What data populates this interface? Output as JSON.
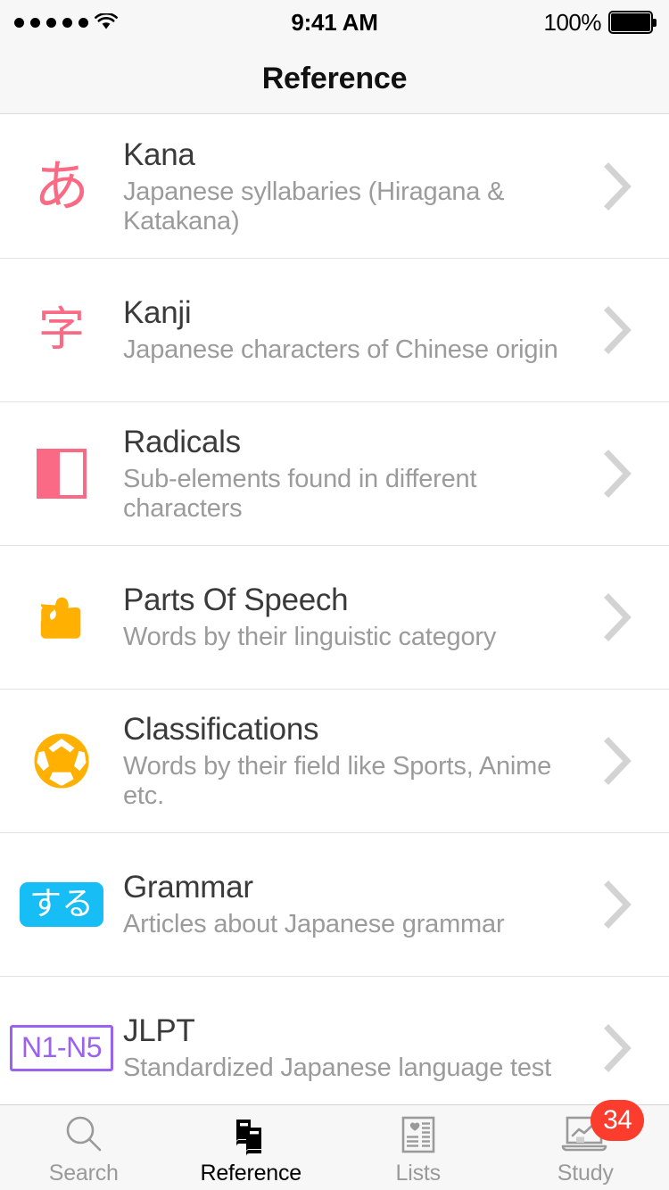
{
  "status_bar": {
    "signal_dots": 5,
    "wifi_icon": "wifi-icon",
    "time": "9:41 AM",
    "battery_percent": "100%",
    "battery_icon": "battery-full-icon"
  },
  "nav": {
    "title": "Reference"
  },
  "list": {
    "items": [
      {
        "icon": "kana-hiragana-a-icon",
        "icon_glyph": "あ",
        "icon_color": "#fb6a84",
        "title": "Kana",
        "subtitle": "Japanese syllabaries (Hiragana & Katakana)",
        "accessory": "chevron-right-icon"
      },
      {
        "icon": "kanji-character-icon",
        "icon_glyph": "字",
        "icon_color": "#fb6a84",
        "title": "Kanji",
        "subtitle": "Japanese characters of Chinese origin",
        "accessory": "chevron-right-icon"
      },
      {
        "icon": "radical-block-icon",
        "icon_glyph": "",
        "icon_color": "#fb6a84",
        "title": "Radicals",
        "subtitle": "Sub-elements found in different characters",
        "accessory": "chevron-right-icon"
      },
      {
        "icon": "puzzle-piece-icon",
        "icon_glyph": "",
        "icon_color": "#ffb000",
        "title": "Parts Of Speech",
        "subtitle": "Words by their linguistic category",
        "accessory": "chevron-right-icon"
      },
      {
        "icon": "soccer-ball-icon",
        "icon_glyph": "",
        "icon_color": "#ffb000",
        "title": "Classifications",
        "subtitle": "Words by their field like Sports, Anime etc.",
        "accessory": "chevron-right-icon"
      },
      {
        "icon": "grammar-suru-icon",
        "icon_glyph": "する",
        "icon_color": "#17bdf5",
        "title": "Grammar",
        "subtitle": "Articles about Japanese grammar",
        "accessory": "chevron-right-icon"
      },
      {
        "icon": "jlpt-level-icon",
        "icon_glyph": "N1-N5",
        "icon_color": "#9a62f0",
        "title": "JLPT",
        "subtitle": "Standardized Japanese language test",
        "accessory": "chevron-right-icon"
      }
    ]
  },
  "tabbar": {
    "tabs": [
      {
        "icon": "search-icon",
        "label": "Search",
        "active": false,
        "badge": ""
      },
      {
        "icon": "books-icon",
        "label": "Reference",
        "active": true,
        "badge": ""
      },
      {
        "icon": "list-card-icon",
        "label": "Lists",
        "active": false,
        "badge": ""
      },
      {
        "icon": "chart-laptop-icon",
        "label": "Study",
        "active": false,
        "badge": "34"
      }
    ],
    "badge_color": "#fc3d2e",
    "active_color": "#000000",
    "inactive_color": "#9a9a9a"
  }
}
